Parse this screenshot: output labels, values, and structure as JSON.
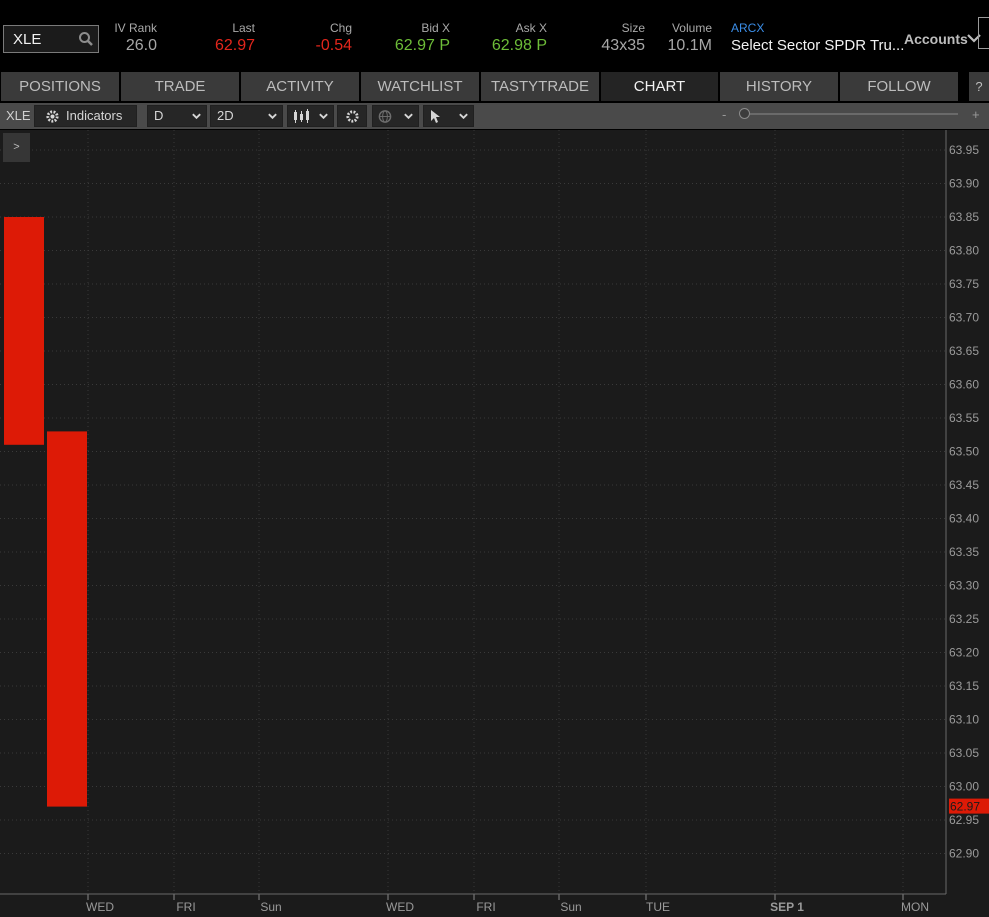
{
  "quote": {
    "symbol": "XLE",
    "fields": [
      {
        "key": "iv_rank",
        "label": "IV Rank",
        "value": "26.0",
        "color": "neutral"
      },
      {
        "key": "last",
        "label": "Last",
        "value": "62.97",
        "color": "red"
      },
      {
        "key": "chg",
        "label": "Chg",
        "value": "-0.54",
        "color": "red"
      },
      {
        "key": "bid",
        "label": "Bid X",
        "value": "62.97 P",
        "color": "green"
      },
      {
        "key": "ask",
        "label": "Ask X",
        "value": "62.98 P",
        "color": "green"
      },
      {
        "key": "size",
        "label": "Size",
        "value": "43x35",
        "color": "neutral"
      },
      {
        "key": "volume",
        "label": "Volume",
        "value": "10.1M",
        "color": "neutral"
      }
    ],
    "exchange_label": "ARCX",
    "description": "Select Sector SPDR Tru...",
    "accounts_label": "Accounts"
  },
  "tabs": [
    {
      "label": "POSITIONS",
      "active": false
    },
    {
      "label": "TRADE",
      "active": false
    },
    {
      "label": "ACTIVITY",
      "active": false
    },
    {
      "label": "WATCHLIST",
      "active": false
    },
    {
      "label": "TASTYTRADE",
      "active": false
    },
    {
      "label": "CHART",
      "active": true
    },
    {
      "label": "HISTORY",
      "active": false
    },
    {
      "label": "FOLLOW",
      "active": false
    },
    {
      "label": "?",
      "active": false
    }
  ],
  "toolbar": {
    "symbol": "XLE",
    "indicators_label": "Indicators",
    "interval": "D",
    "range": "2D",
    "zoom_minus": "-",
    "zoom_plus": "+",
    "zoom_level": 0.0
  },
  "chart_data": {
    "type": "candlestick",
    "expand_label": ">",
    "ylim": [
      62.86,
      63.97
    ],
    "y_ticks": [
      "63.95",
      "63.90",
      "63.85",
      "63.80",
      "63.75",
      "63.70",
      "63.65",
      "63.60",
      "63.55",
      "63.50",
      "63.45",
      "63.40",
      "63.35",
      "63.30",
      "63.25",
      "63.20",
      "63.15",
      "63.10",
      "63.05",
      "63.00",
      "62.95",
      "62.90"
    ],
    "x_ticks": [
      "WED",
      "FRI",
      "Sun",
      "WED",
      "FRI",
      "Sun",
      "TUE",
      "SEP 1",
      "MON"
    ],
    "candles": [
      {
        "open": 63.85,
        "close": 63.51,
        "color": "#dd1a06"
      },
      {
        "open": 63.53,
        "close": 62.97,
        "color": "#dd1a06"
      }
    ],
    "last_price_label": "62.97",
    "colors": {
      "down": "#dd1a06",
      "background": "#1b1b1b",
      "grid": "#3a3a3a",
      "axis_text": "#9a9a9a"
    }
  }
}
